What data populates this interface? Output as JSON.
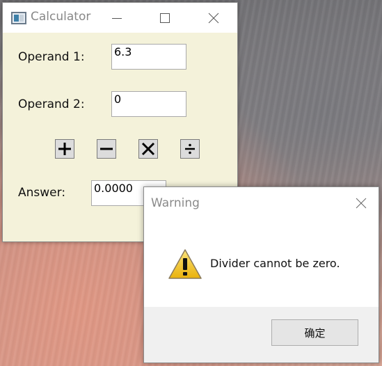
{
  "calculator": {
    "title": "Calculator",
    "operand1_label": "Operand 1:",
    "operand1_value": "6.3",
    "operand2_label": "Operand 2:",
    "operand2_value": "0",
    "answer_label": "Answer:",
    "answer_value": "0.0000",
    "operators": [
      "plus",
      "minus",
      "multiply",
      "divide"
    ]
  },
  "warning": {
    "title": "Warning",
    "message": "Divider cannot be zero.",
    "ok_label": "确定",
    "icon": "warning-triangle-icon"
  },
  "colors": {
    "calc_background": "#f4f2da",
    "warning_yellow": "#f2c619"
  }
}
